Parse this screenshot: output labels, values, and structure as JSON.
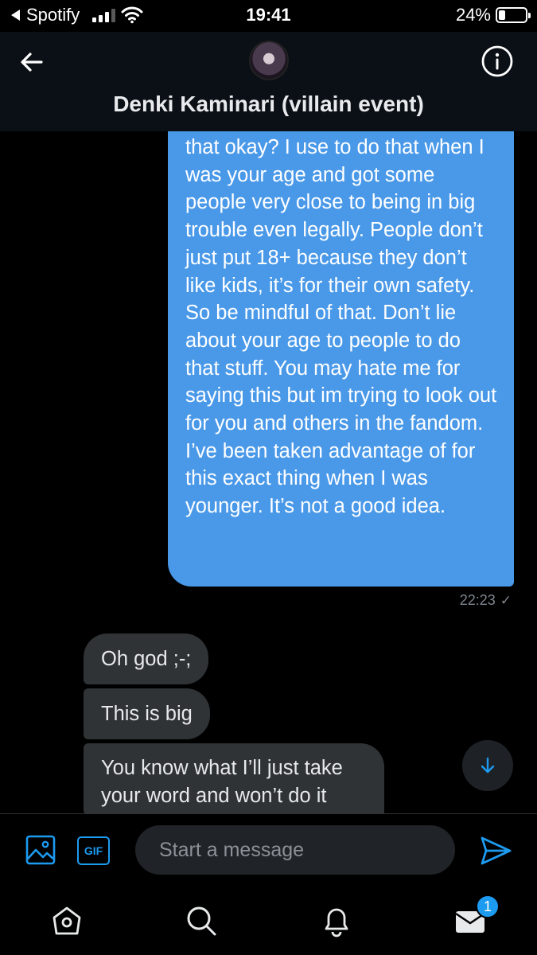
{
  "status_bar": {
    "back_app": "Spotify",
    "time": "19:41",
    "battery_percent": "24%",
    "battery_level": 0.24
  },
  "header": {
    "title": "Denki Kaminari (villain event)",
    "icons": [
      "back-arrow-icon",
      "avatar",
      "info-icon"
    ]
  },
  "messages": {
    "outgoing_text": "that okay? I use to do that when I was your age and got some people very close to being in big trouble even legally. People don’t just put 18+ because they don’t like kids, it’s for their own safety. So be mindful of that. Don’t lie about your age to people to do that stuff. You may hate me for saying this but im trying to look out for you and others in the fandom. I’ve been taken advantage of for this exact thing when I was younger. It’s not a good idea.",
    "outgoing_time": "22:23",
    "outgoing_status_icon": "check-icon",
    "incoming": [
      "Oh god ;-;",
      "This is big",
      "You know what I’ll just take your word and won’t do it"
    ]
  },
  "composer": {
    "placeholder": "Start a message",
    "gif_label": "GIF",
    "icons": [
      "image-icon",
      "gif-icon",
      "send-icon"
    ]
  },
  "bottom_nav": {
    "icons": [
      "home-icon",
      "search-icon",
      "bell-icon",
      "mail-icon"
    ],
    "mail_badge": "1"
  },
  "colors": {
    "accent": "#1d9bf0",
    "outgoing_bubble": "#4a99e9",
    "incoming_bubble": "#2f3336",
    "background": "#000000"
  }
}
